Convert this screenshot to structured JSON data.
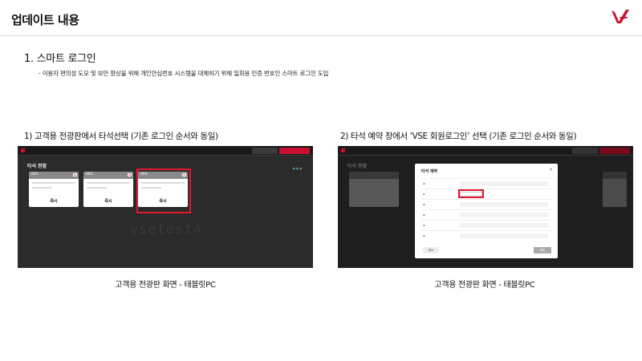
{
  "header": {
    "title": "업데이트 내용",
    "brand_color": "#c8102e"
  },
  "section": {
    "heading": "1. 스마트 로그인",
    "description": "- 이용자 편의성 도모 및 보안 향상을 위해 개인안심번호 시스템을 대체하기 위해 일회용 인증 번호인 스마트 로그인 도입"
  },
  "left_panel": {
    "caption_top": "1) 고객용 전광판에서 타석선택 (기존 로그인 순서와 동일)",
    "caption_bottom": "고객용 전광판 화면 - 태블릿PC",
    "screen": {
      "title": "타석 현황",
      "watermark": "vsetest4",
      "seats": [
        {
          "number": "001",
          "status": "즉시"
        },
        {
          "number": "002",
          "status": "즉시"
        },
        {
          "number": "003",
          "status": "즉시"
        }
      ],
      "selected_seat": "003"
    }
  },
  "right_panel": {
    "caption_top": "2) 타석 예약 창에서 ‘VSE 회원로그인’ 선택 (기존 로그인 순서와 동일)",
    "caption_bottom": "고객용 전광판 화면 - 태블릿PC",
    "screen": {
      "background_title": "타석 현황",
      "modal_title": "타석 예약",
      "modal_close": "×",
      "cancel_label": "취소",
      "confirm_label": "확인"
    }
  }
}
